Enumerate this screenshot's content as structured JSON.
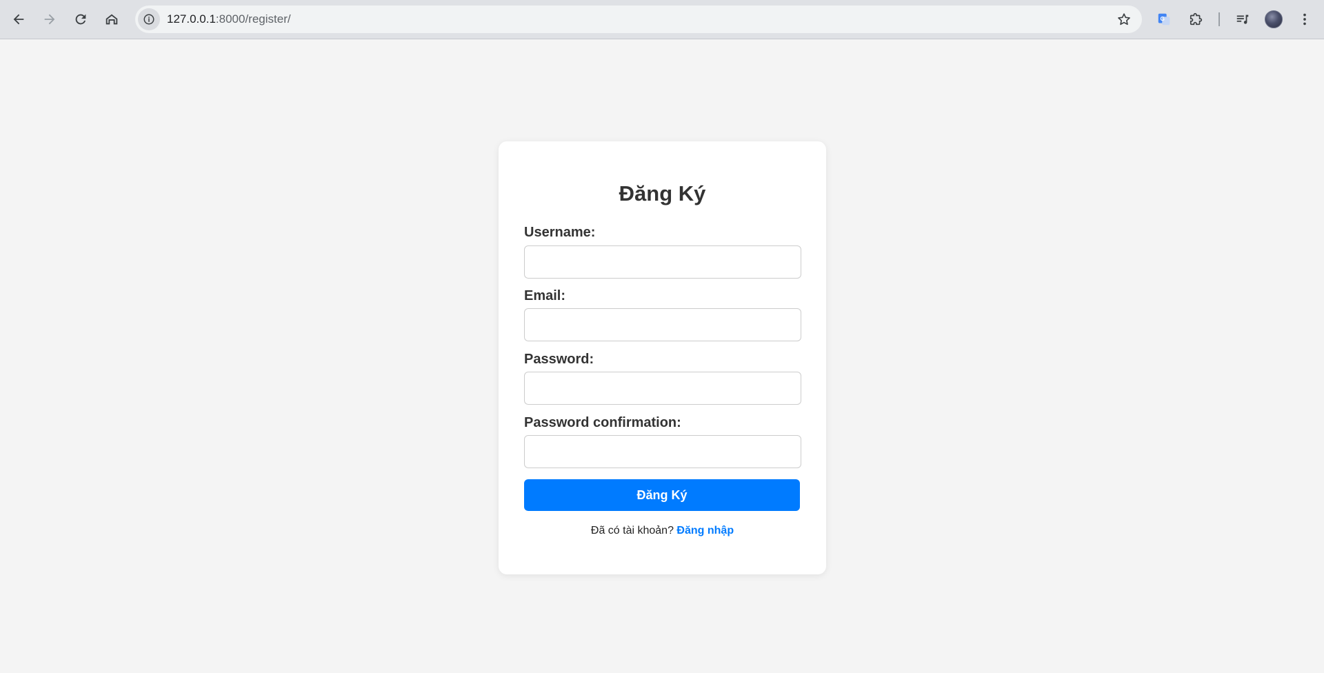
{
  "browser": {
    "url_host": "127.0.0.1",
    "url_path": ":8000/register/",
    "icons": [
      "back-icon",
      "forward-icon",
      "reload-icon",
      "home-icon",
      "site-info-icon",
      "bookmark-star-icon",
      "google-translate-icon",
      "extensions-icon",
      "media-control-icon",
      "profile-avatar",
      "menu-icon"
    ]
  },
  "form": {
    "title": "Đăng Ký",
    "username_label": "Username:",
    "email_label": "Email:",
    "password_label": "Password:",
    "password_confirm_label": "Password confirmation:",
    "username_value": "",
    "email_value": "",
    "password_value": "",
    "password_confirm_value": "",
    "submit_label": "Đăng Ký",
    "have_account_text": "Đã có tài khoản?",
    "login_link": "Đăng nhập"
  },
  "colors": {
    "accent": "#007bff",
    "page_bg": "#f4f4f4",
    "card_bg": "#ffffff",
    "text": "#333333"
  }
}
